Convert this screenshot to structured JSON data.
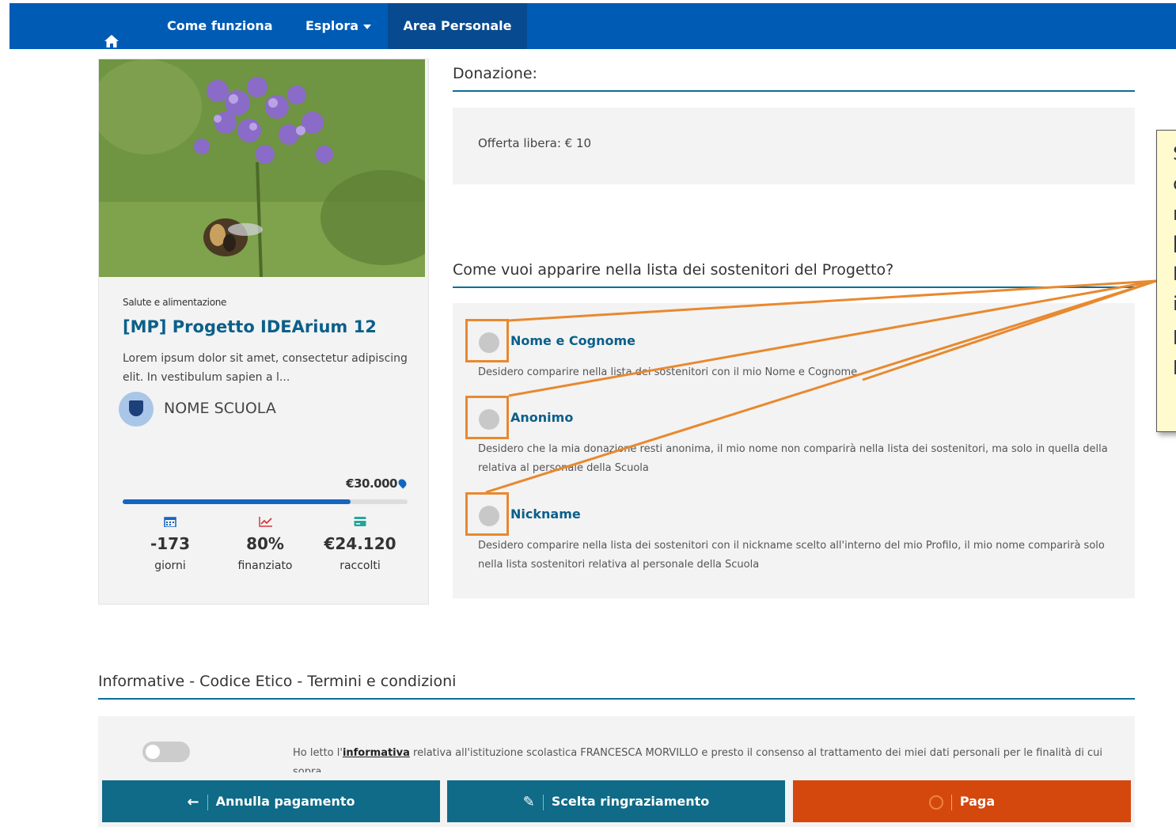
{
  "nav": {
    "home_icon": "home-icon",
    "come_funziona": "Come funziona",
    "esplora": "Esplora",
    "area_personale": "Area Personale"
  },
  "project": {
    "category": "Salute e alimentazione",
    "title": "[MP] Progetto IDEArium 12",
    "description": "Lorem ipsum dolor sit amet, consectetur adipiscing elit. In vestibulum sapien a l...",
    "school": "NOME SCUOLA",
    "goal": "€30.000",
    "progress_fraction": 0.8,
    "stats": [
      {
        "icon": "calendar-icon",
        "value": "-173",
        "label": "giorni"
      },
      {
        "icon": "chart-icon",
        "value": "80%",
        "label": "finanziato"
      },
      {
        "icon": "card-icon",
        "value": "€24.120",
        "label": "raccolti"
      }
    ]
  },
  "donation": {
    "section_title": "Donazione:",
    "offer": "Offerta libera: € 10"
  },
  "appearance": {
    "section_title": "Come vuoi apparire nella lista dei sostenitori del Progetto?",
    "options": [
      {
        "label": "Nome e Cognome",
        "desc": "Desidero comparire nella lista dei sostenitori con il mio Nome e Cognome"
      },
      {
        "label": "Anonimo",
        "desc": "Desidero che la mia donazione resti anonima, il mio nome non comparirà nella lista dei sostenitori, ma solo in quella della relativa al personale della Scuola"
      },
      {
        "label": "Nickname",
        "desc": "Desidero comparire nella lista dei sostenitori con il  nickname scelto all'interno del mio Profilo, il mio nome comparirà solo nella lista sostenitori relativa al personale della Scuola"
      }
    ]
  },
  "callout": {
    "lines": [
      "S",
      "c",
      "r",
      "[",
      "I",
      "i",
      "p",
      "p"
    ]
  },
  "terms": {
    "section_title": "Informative - Codice Etico - Termini e condizioni",
    "consent_before": "Ho letto l'",
    "consent_link": "informativa",
    "consent_after": " relativa all'istituzione scolastica FRANCESCA MORVILLO e presto il consenso al trattamento dei miei dati personali per le finalità di cui sopra"
  },
  "actions": {
    "cancel": "Annulla pagamento",
    "thanks": "Scelta ringraziamento",
    "pay": "Paga"
  },
  "colors": {
    "nav": "#005bb5",
    "accent_title": "#0b5f8a",
    "highlight_box": "#e8892f",
    "cancel_button": "#0f6b87",
    "pay_button": "#d4480e"
  }
}
